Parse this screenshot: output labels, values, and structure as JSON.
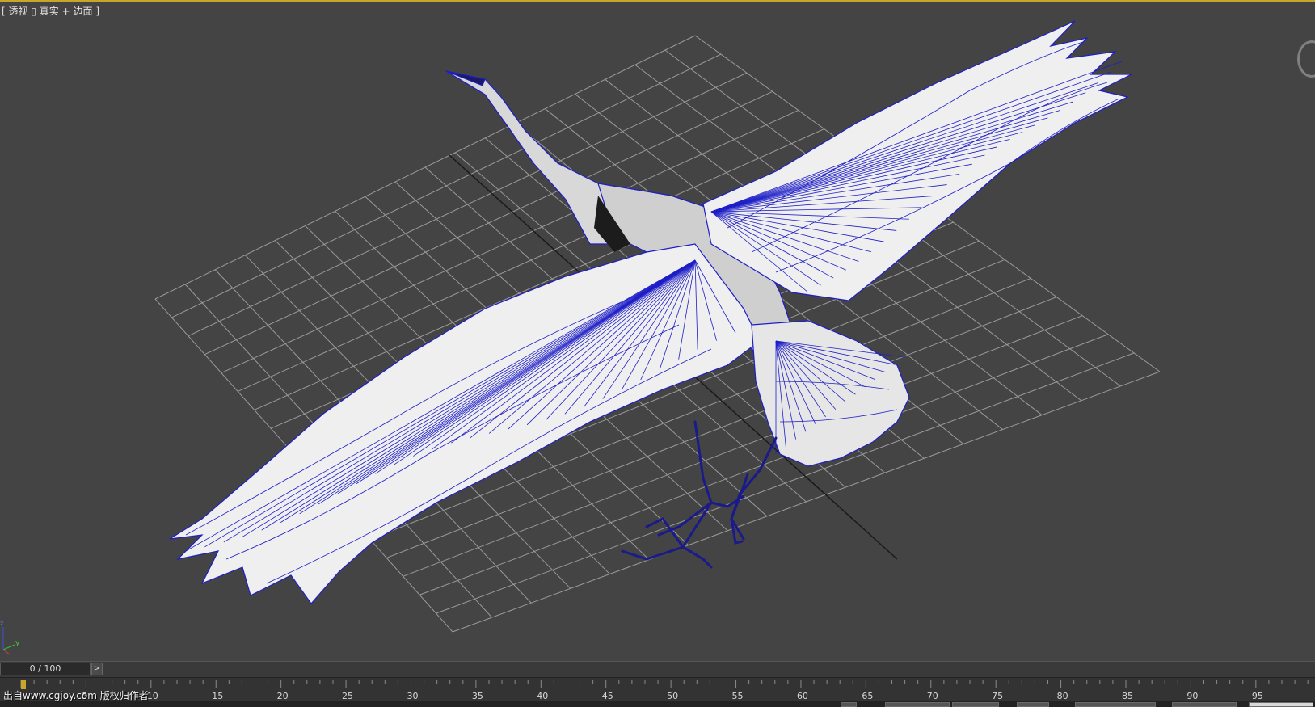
{
  "viewport": {
    "label_open": "[",
    "view_name": "透视",
    "shading_name": "真实 + 边面",
    "label_close": "]"
  },
  "axis_tripod": {
    "x_label": "x",
    "y_label": "y",
    "z_label": "z"
  },
  "time_slider": {
    "frame_display": "0 / 100",
    "next_button": ">"
  },
  "track_bar": {
    "ticks": [
      "5",
      "10",
      "15",
      "20",
      "25",
      "30",
      "35",
      "40",
      "45",
      "50",
      "55",
      "60",
      "65",
      "70",
      "75",
      "80",
      "85",
      "90",
      "95"
    ],
    "current_frame": 0
  },
  "watermark": "出自www.cgjoy.com 版权归作者",
  "colors": {
    "viewport_bg": "#444444",
    "grid": "#9a9a9a",
    "wire": "#1e1ec8",
    "mesh": "#eeeeee",
    "active_border": "#c8a628"
  }
}
